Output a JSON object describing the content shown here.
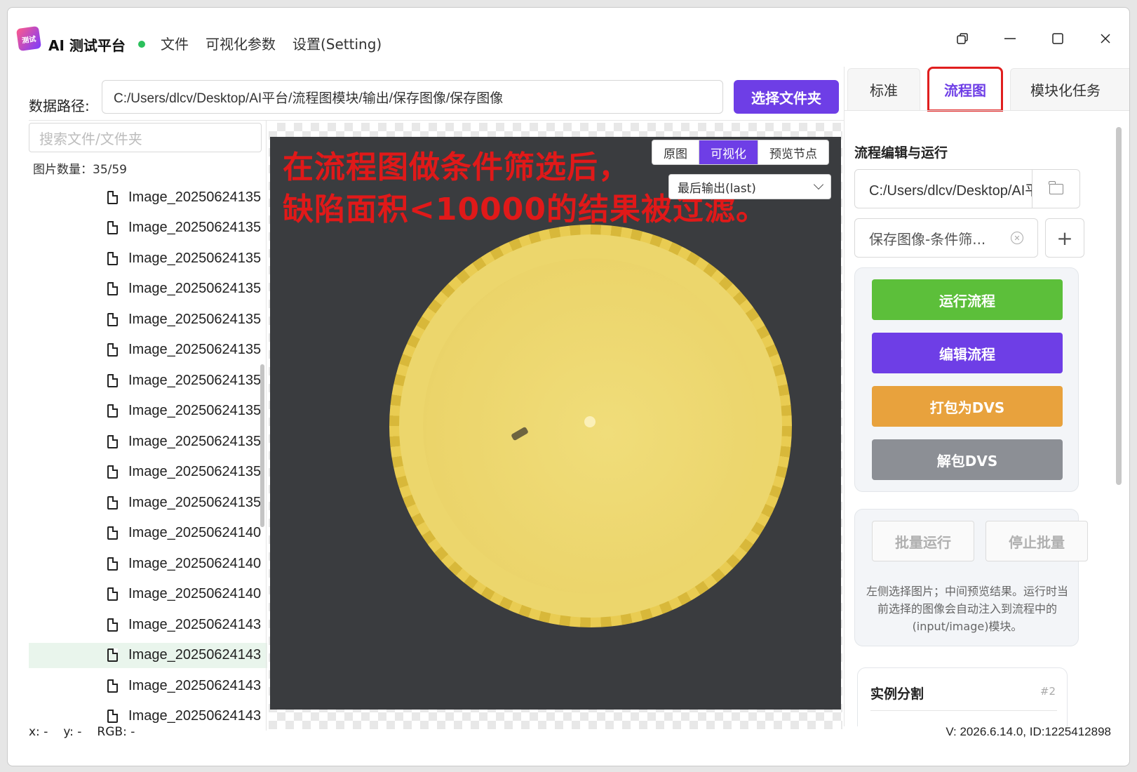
{
  "app": {
    "logo_text": "测试",
    "title": "AI 测试平台"
  },
  "menu": [
    "文件",
    "可视化参数",
    "设置(Setting)"
  ],
  "window_controls": [
    "restore-icon",
    "minimize-icon",
    "maximize-icon",
    "close-icon"
  ],
  "path_bar": {
    "label": "数据路径:",
    "value": "C:/Users/dlcv/Desktop/AI平台/流程图模块/输出/保存图像/保存图像",
    "choose_button": "选择文件夹"
  },
  "file_panel": {
    "search_placeholder": "搜索文件/文件夹",
    "count_label": "图片数量：35/59",
    "files": [
      "Image_20250624135",
      "Image_20250624135",
      "Image_20250624135",
      "Image_20250624135",
      "Image_20250624135",
      "Image_20250624135",
      "Image_20250624135",
      "Image_20250624135",
      "Image_20250624135",
      "Image_20250624135",
      "Image_20250624135",
      "Image_20250624140",
      "Image_20250624140",
      "Image_20250624140",
      "Image_20250624143",
      "Image_20250624143",
      "Image_20250624143",
      "Image_20250624143"
    ],
    "selected_index": 15
  },
  "viewer": {
    "annotation_lines": [
      "在流程图做条件筛选后，",
      "缺陷面积<10000的结果被过滤。"
    ],
    "view_tabs": [
      "原图",
      "可视化",
      "预览节点"
    ],
    "active_view_tab": 1,
    "output_select": "最后输出(last)"
  },
  "status": {
    "x": "x: -",
    "y": "y: -",
    "rgb": "RGB: -",
    "version": "V: 2026.6.14.0, ID:1225412898"
  },
  "right_panel": {
    "tabs": [
      "标准",
      "流程图",
      "模块化任务"
    ],
    "active_tab": 1,
    "section_title": "流程编辑与运行",
    "flow_path": "C:/Users/dlcv/Desktop/AI平台",
    "flow_select": "保存图像-条件筛...",
    "add_label": "+",
    "actions": [
      {
        "label": "运行流程",
        "color": "#5cbf3a"
      },
      {
        "label": "编辑流程",
        "color": "#6e3ee6"
      },
      {
        "label": "打包为DVS",
        "color": "#e8a23d"
      },
      {
        "label": "解包DVS",
        "color": "#8c8f95"
      }
    ],
    "batch": {
      "run_label": "批量运行",
      "stop_label": "停止批量",
      "hint": "左侧选择图片；中间预览结果。运行时当前选择的图像会自动注入到流程中的(input/image)模块。"
    },
    "module_card": {
      "title": "实例分割",
      "id": "#2"
    }
  },
  "colors": {
    "accent": "#6e3ee6",
    "annotation": "#e01919",
    "highlight_box": "#e01e1e",
    "status_dot": "#2bc05c"
  }
}
